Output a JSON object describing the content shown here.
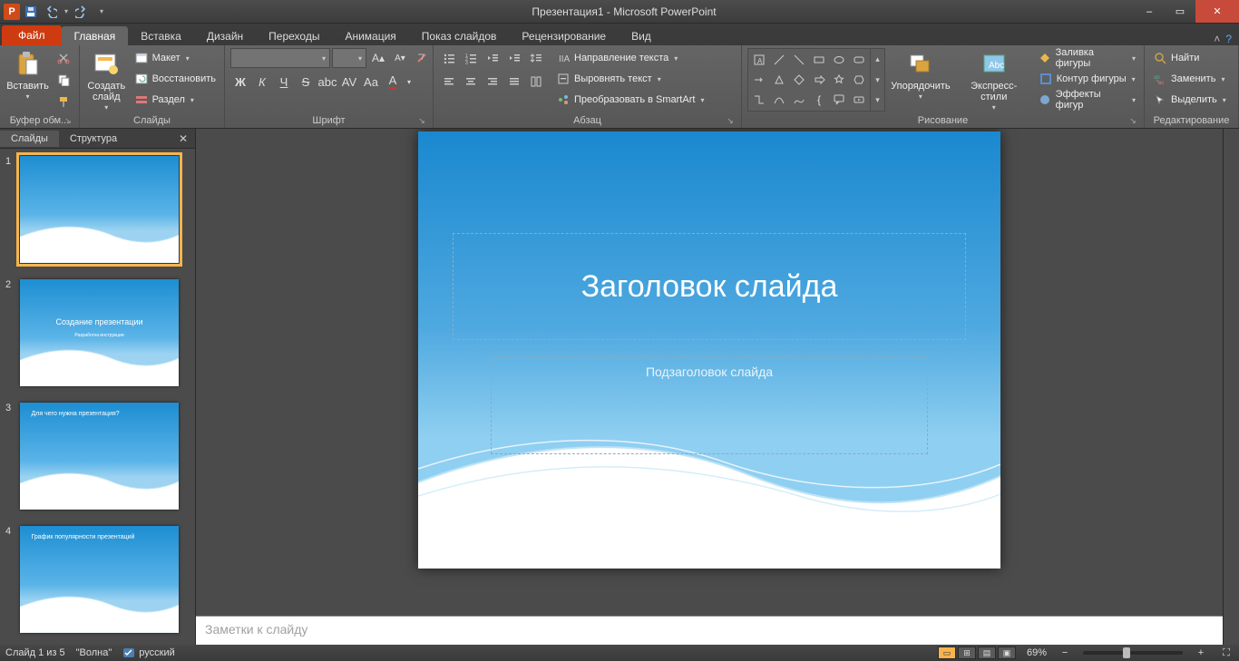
{
  "app": {
    "title": "Презентация1 - Microsoft PowerPoint",
    "icon_letter": "P"
  },
  "qat": {
    "save": "save",
    "undo": "undo",
    "redo": "redo"
  },
  "window_buttons": {
    "min": "–",
    "max": "▭",
    "close": "✕"
  },
  "tabs": {
    "file": "Файл",
    "items": [
      "Главная",
      "Вставка",
      "Дизайн",
      "Переходы",
      "Анимация",
      "Показ слайдов",
      "Рецензирование",
      "Вид"
    ],
    "active_index": 0
  },
  "ribbon": {
    "clipboard": {
      "label": "Буфер обм...",
      "paste": "Вставить"
    },
    "slides": {
      "label": "Слайды",
      "new_slide": "Создать\nслайд",
      "layout": "Макет",
      "reset": "Восстановить",
      "section": "Раздел"
    },
    "font": {
      "label": "Шрифт",
      "size_placeholder": "",
      "font_placeholder": ""
    },
    "paragraph": {
      "label": "Абзац",
      "text_direction": "Направление текста",
      "align_text": "Выровнять текст",
      "convert_smartart": "Преобразовать в SmartArt"
    },
    "drawing": {
      "label": "Рисование",
      "arrange": "Упорядочить",
      "quick_styles": "Экспресс-стили",
      "shape_fill": "Заливка фигуры",
      "shape_outline": "Контур фигуры",
      "shape_effects": "Эффекты фигур"
    },
    "editing": {
      "label": "Редактирование",
      "find": "Найти",
      "replace": "Заменить",
      "select": "Выделить"
    }
  },
  "sidepanel": {
    "tabs": {
      "slides": "Слайды",
      "outline": "Структура"
    },
    "thumbs": [
      {
        "num": "1",
        "title": "",
        "subtitle": "",
        "selected": true,
        "layout": "title"
      },
      {
        "num": "2",
        "title": "Создание презентации",
        "subtitle": "Разработка  инструкции",
        "selected": false,
        "layout": "title"
      },
      {
        "num": "3",
        "title": "Для чего нужна презентация?",
        "subtitle": "",
        "selected": false,
        "layout": "content"
      },
      {
        "num": "4",
        "title": "График популярности презентаций",
        "subtitle": "",
        "selected": false,
        "layout": "content"
      }
    ]
  },
  "slide": {
    "title_placeholder": "Заголовок слайда",
    "subtitle_placeholder": "Подзаголовок слайда"
  },
  "notes": {
    "placeholder": "Заметки к слайду"
  },
  "status": {
    "slide_pos": "Слайд 1 из 5",
    "theme": "\"Волна\"",
    "language": "русский",
    "zoom": "69%"
  }
}
